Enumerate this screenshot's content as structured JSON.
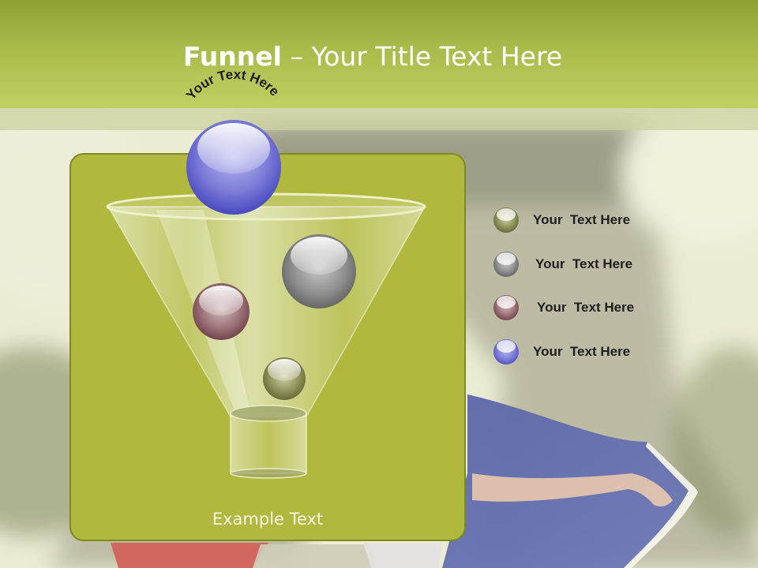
{
  "slide": {
    "title_bold": "Funnel",
    "title_rest": " – Your Title Text Here",
    "arc_text": "Your Text Here",
    "example_text": "Example Text"
  },
  "legend": [
    {
      "label": "Your  Text Here",
      "color": "#7d8140"
    },
    {
      "label": "Your  Text Here",
      "color": "#6d6f72"
    },
    {
      "label": "Your  Text Here",
      "color": "#7a4a52"
    },
    {
      "label": "Your  Text Here",
      "color": "#5a5acf"
    }
  ],
  "colors": {
    "title_band": "#a9bb4b",
    "panel": "#b0b93d",
    "panel_border": "#7d8a22",
    "ball_top": "#5f5fd6",
    "ball_grey": "#707070",
    "ball_red": "#7a4a52",
    "ball_olive": "#7d8140"
  }
}
